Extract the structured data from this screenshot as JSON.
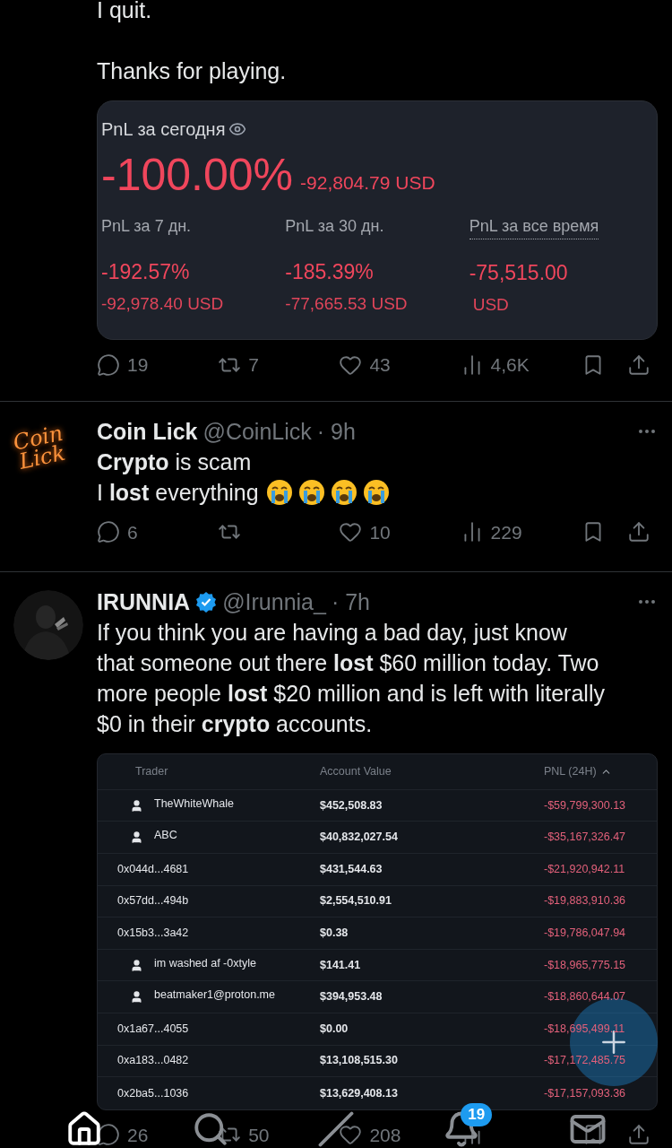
{
  "tweet_1": {
    "text_lines": [
      "I quit.",
      "Thanks for playing."
    ],
    "pnl_card": {
      "title": "PnL за сегодня",
      "today_percent": "-100.00%",
      "today_usd": "-92,804.79 USD",
      "periods": [
        {
          "label": "PnL за 7 дн.",
          "percent": "-192.57%",
          "usd": "-92,978.40 USD",
          "dotted": false
        },
        {
          "label": "PnL за 30 дн.",
          "percent": "-185.39%",
          "usd": "-77,665.53 USD",
          "dotted": false
        },
        {
          "label": "PnL за все время",
          "percent": "-75,515.00",
          "usd": "USD",
          "dotted": true
        }
      ]
    },
    "actions": [
      {
        "kind": "reply",
        "count": "19"
      },
      {
        "kind": "retweet",
        "count": "7"
      },
      {
        "kind": "like",
        "count": "43"
      },
      {
        "kind": "views",
        "count": "4,6K"
      },
      {
        "kind": "bookmark"
      },
      {
        "kind": "share"
      }
    ]
  },
  "tweet_2": {
    "avatar_logo": [
      "Coin",
      "Lick"
    ],
    "name": "Coin Lick",
    "verified": false,
    "handle": "@CoinLick",
    "time": "· 9h",
    "text_lines": [
      "**Crypto** is scam",
      "I **lost** everything"
    ],
    "emojis": [
      {
        "kind": "loudly_crying"
      },
      {
        "kind": "loudly_crying"
      },
      {
        "kind": "loudly_crying"
      },
      {
        "kind": "loudly_crying"
      }
    ],
    "actions": [
      {
        "kind": "reply",
        "count": "6"
      },
      {
        "kind": "retweet"
      },
      {
        "kind": "like",
        "count": "10"
      },
      {
        "kind": "views",
        "count": "229"
      },
      {
        "kind": "bookmark"
      },
      {
        "kind": "share"
      }
    ]
  },
  "tweet_3": {
    "name": "IRUNNIA",
    "verified": true,
    "handle": "@Irunnia_",
    "time": "· 7h",
    "text": "If you think you are having a bad day, just know that someone out there **lost** $60 million today. Two more people **lost** $20 million and is left with literally $0 in their **crypto** accounts.",
    "table": {
      "columns": [
        "Trader",
        "Account Value",
        "PNL (24H)"
      ],
      "rows": [
        {
          "trader": "TheWhiteWhale",
          "user_icon": true,
          "account_value": "$452,508.83",
          "pnl": "-$59,799,300.13"
        },
        {
          "trader": "ABC",
          "user_icon": true,
          "account_value": "$40,832,027.54",
          "pnl": "-$35,167,326.47"
        },
        {
          "trader": "0x044d...4681",
          "user_icon": false,
          "account_value": "$431,544.63",
          "pnl": "-$21,920,942.11"
        },
        {
          "trader": "0x57dd...494b",
          "user_icon": false,
          "account_value": "$2,554,510.91",
          "pnl": "-$19,883,910.36"
        },
        {
          "trader": "0x15b3...3a42",
          "user_icon": false,
          "account_value": "$0.38",
          "pnl": "-$19,786,047.94"
        },
        {
          "trader": "im washed af -0xtyle",
          "user_icon": true,
          "account_value": "$141.41",
          "pnl": "-$18,965,775.15"
        },
        {
          "trader": "beatmaker1@proton.me",
          "user_icon": true,
          "account_value": "$394,953.48",
          "pnl": "-$18,860,644.07"
        },
        {
          "trader": "0x1a67...4055",
          "user_icon": false,
          "account_value": "$0.00",
          "pnl": "-$18,695,499.11"
        },
        {
          "trader": "0xa183...0482",
          "user_icon": false,
          "account_value": "$13,108,515.30",
          "pnl": "-$17,172,485.75"
        },
        {
          "trader": "0x2ba5...1036",
          "user_icon": false,
          "account_value": "$13,629,408.13",
          "pnl": "-$17,157,093.36"
        }
      ]
    },
    "actions": [
      {
        "kind": "reply",
        "count": "26"
      },
      {
        "kind": "retweet",
        "count": "50"
      },
      {
        "kind": "like",
        "count": "208"
      },
      {
        "kind": "views"
      },
      {
        "kind": "bookmark"
      },
      {
        "kind": "share"
      }
    ]
  },
  "bottom_nav": {
    "items": [
      {
        "kind": "home",
        "selected": true
      },
      {
        "kind": "search",
        "selected": false
      },
      {
        "kind": "grok",
        "selected": false
      },
      {
        "kind": "notifications",
        "selected": false,
        "badge": "19"
      },
      {
        "kind": "messages",
        "selected": false
      }
    ]
  }
}
